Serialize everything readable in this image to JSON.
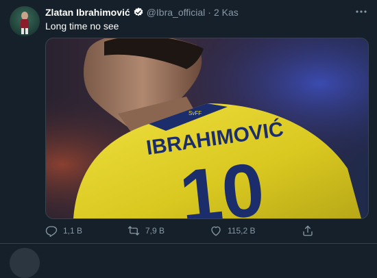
{
  "tweet": {
    "author_name": "Zlatan Ibrahimović",
    "handle": "@Ibra_official",
    "separator": "·",
    "date": "2 Kas",
    "text": "Long time no see",
    "media": {
      "jersey_name": "IBRAHIMOVIĆ",
      "jersey_number": "10",
      "collar_text": "SvFF"
    },
    "actions": {
      "replies": "1,1 B",
      "retweets": "7,9 B",
      "likes": "115,2 B"
    },
    "colors": {
      "background": "#15202b",
      "secondary_text": "#8899a6",
      "verified": "#ffffff",
      "jersey_yellow": "#e8d930",
      "jersey_blue": "#1c2d6b"
    }
  },
  "icons": {
    "more": "more-horizontal-icon",
    "verified": "verified-badge-icon",
    "reply": "reply-icon",
    "retweet": "retweet-icon",
    "like": "like-icon",
    "share": "share-icon"
  }
}
